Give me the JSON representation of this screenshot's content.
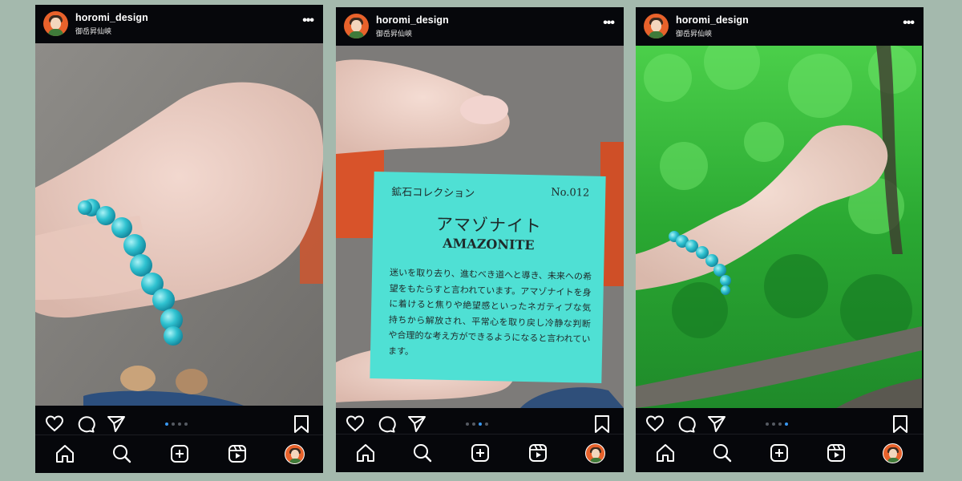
{
  "posts": [
    {
      "username": "horomi_design",
      "location": "御岳昇仙峡",
      "carousel": {
        "count": 4,
        "active": 0
      },
      "photo": {
        "subject": "turquoise bead bracelet on wrist"
      }
    },
    {
      "username": "horomi_design",
      "location": "御岳昇仙峡",
      "carousel": {
        "count": 4,
        "active": 2
      },
      "photo": {
        "subject": "mineral collection card held between fingers"
      },
      "card": {
        "series": "鉱石コレクション",
        "number": "No.012",
        "name_jp": "アマゾナイト",
        "name_en": "AMAZONITE",
        "description": "迷いを取り去り、進むべき道へと導き、未来への希望をもたらすと言われています。アマゾナイトを身に着けると焦りや絶望感といったネガティブな気持ちから解放され、平常心を取り戻し冷静な判断や合理的な考え方ができるようになると言われています。"
      }
    },
    {
      "username": "horomi_design",
      "location": "御岳昇仙峡",
      "carousel": {
        "count": 4,
        "active": 3
      },
      "photo": {
        "subject": "raised arm with bracelet against green forest"
      }
    }
  ],
  "icons": {
    "like": "heart-icon",
    "comment": "comment-icon",
    "share": "paper-plane-icon",
    "save": "bookmark-icon",
    "nav": [
      "home-icon",
      "search-icon",
      "create-post-icon",
      "reels-icon",
      "profile-avatar"
    ]
  },
  "colors": {
    "background": "#a4b9ad",
    "app_bg": "#06070b",
    "accent_dot": "#3897f0",
    "bracelet": "#2fc2d0",
    "card": "#4fe0d4",
    "avatar": "#e8622b"
  }
}
